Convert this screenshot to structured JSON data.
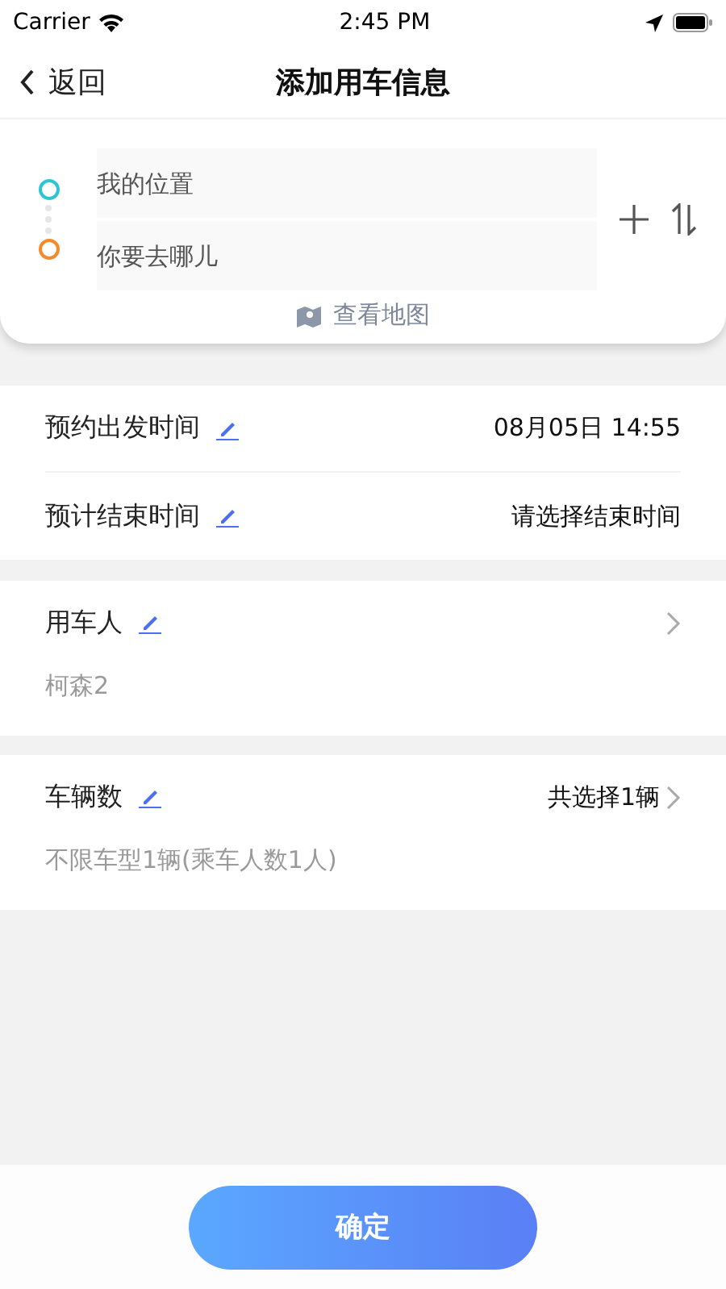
{
  "status_bar": {
    "carrier": "Carrier",
    "time": "2:45 PM"
  },
  "nav": {
    "back_label": "返回",
    "title": "添加用车信息"
  },
  "route": {
    "stops": [
      {
        "placeholder": "我的位置",
        "color": "#2ec5d3"
      },
      {
        "placeholder": "你要去哪儿",
        "color": "#f58a2c"
      }
    ],
    "map_link": "查看地图"
  },
  "time_rows": [
    {
      "label": "预约出发时间",
      "value": "08月05日 14:55"
    },
    {
      "label": "预计结束时间",
      "value": "请选择结束时间"
    }
  ],
  "passenger": {
    "label": "用车人",
    "value": "柯森2"
  },
  "vehicles": {
    "label": "车辆数",
    "summary": "共选择1辆",
    "detail": "不限车型1辆(乘车人数1人)"
  },
  "confirm_button": "确定"
}
